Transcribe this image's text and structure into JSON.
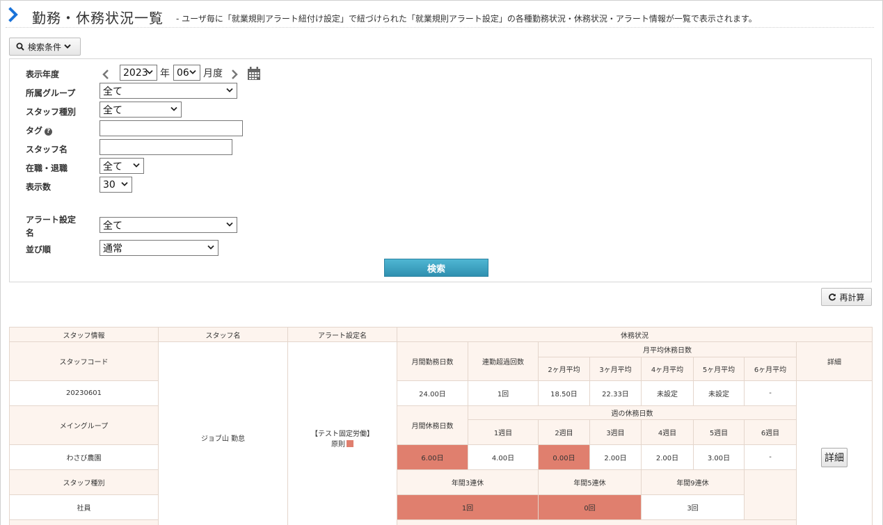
{
  "header": {
    "title": "勤務・休務状況一覧",
    "description": "- ユーザ毎に「就業規則アラート紐付け設定」で紐づけられた「就業規則アラート設定」の各種勤務状況・休務状況・アラート情報が一覧で表示されます。"
  },
  "search_toggle": {
    "label": "検索条件"
  },
  "form": {
    "year_label": "表示年度",
    "year_value": "2023",
    "year_unit": "年",
    "month_value": "06",
    "month_unit": "月度",
    "group_label": "所属グループ",
    "group_value": "全て",
    "staff_type_label": "スタッフ種別",
    "staff_type_value": "全て",
    "tag_label": "タグ",
    "tag_value": "",
    "staff_name_label": "スタッフ名",
    "staff_name_value": "",
    "employment_label": "在職・退職",
    "employment_value": "全て",
    "count_label": "表示数",
    "count_value": "30",
    "alert_label_1": "アラート設定",
    "alert_label_2": "名",
    "alert_value": "全て",
    "sort_label": "並び順",
    "sort_value": "通常",
    "search_button": "検索"
  },
  "recalc_button": "再計算",
  "table": {
    "col_staff_info": "スタッフ情報",
    "col_staff_name": "スタッフ名",
    "col_alert_name": "アラート設定名",
    "col_rest_status": "休務状況",
    "staff_code_label": "スタッフコード",
    "monthly_work_days": "月間勤務日数",
    "consecutive_over": "連勤超過回数",
    "monthly_avg_rest": "月平均休務日数",
    "avg_2m": "2ヶ月平均",
    "avg_3m": "3ヶ月平均",
    "avg_4m": "4ヶ月平均",
    "avg_5m": "5ヶ月平均",
    "avg_6m": "6ヶ月平均",
    "detail_header": "詳細",
    "staff_code": "20230601",
    "work_days_value": "24.00日",
    "over_value": "1回",
    "avg_2m_value": "18.50日",
    "avg_3m_value": "22.33日",
    "avg_4m_value": "未設定",
    "avg_5m_value": "未設定",
    "avg_6m_value": "-",
    "main_group_label": "メイングループ",
    "staff_name": "ジョブ山 勤怠",
    "alert_name_line1": "【テスト固定労働】",
    "alert_name_line2": "原則",
    "monthly_rest_days": "月間休務日数",
    "weekly_rest_days": "週の休務日数",
    "week1": "1週目",
    "week2": "2週目",
    "week3": "3週目",
    "week4": "4週目",
    "week5": "5週目",
    "week6": "6週目",
    "main_group": "わさび農園",
    "monthly_rest_value": "6.00日",
    "w1_value": "4.00日",
    "w2_value": "0.00日",
    "w3_value": "2.00日",
    "w4_value": "2.00日",
    "w5_value": "3.00日",
    "w6_value": "-",
    "detail_button": "詳細",
    "staff_type_label": "スタッフ種別",
    "annual_3": "年間3連休",
    "annual_5": "年間5連休",
    "annual_9": "年間9連休",
    "staff_type": "社員",
    "annual_3_value": "1回",
    "annual_5_value": "0回",
    "annual_9_value": "3回"
  },
  "colors": {
    "accent": "#1a73d9",
    "header_cell": "#fdf4ee",
    "alert_cell": "#e07f6e",
    "search_button": "#3a9fc0"
  }
}
